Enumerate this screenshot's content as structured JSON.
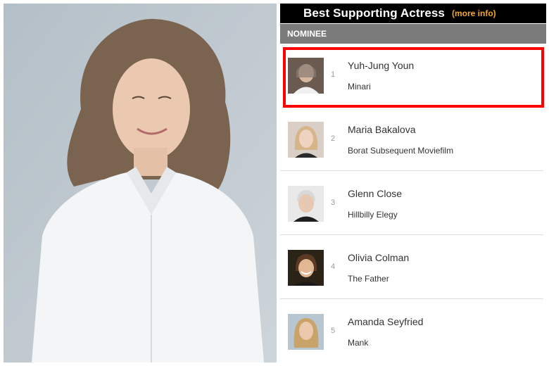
{
  "header": {
    "title": "Best Supporting Actress",
    "more_info": "(more info)"
  },
  "table": {
    "column_header": "NOMINEE"
  },
  "nominees": [
    {
      "rank": "1",
      "name": "Yuh-Jung Youn",
      "film": "Minari"
    },
    {
      "rank": "2",
      "name": "Maria Bakalova",
      "film": "Borat Subsequent Moviefilm"
    },
    {
      "rank": "3",
      "name": "Glenn Close",
      "film": "Hillbilly Elegy"
    },
    {
      "rank": "4",
      "name": "Olivia Colman",
      "film": "The Father"
    },
    {
      "rank": "5",
      "name": "Amanda Seyfried",
      "film": "Mank"
    }
  ],
  "colors": {
    "highlight": "#ff0000",
    "more_info": "#f5a623",
    "header_bg": "#000000",
    "column_header_bg": "#7b7b7b"
  }
}
